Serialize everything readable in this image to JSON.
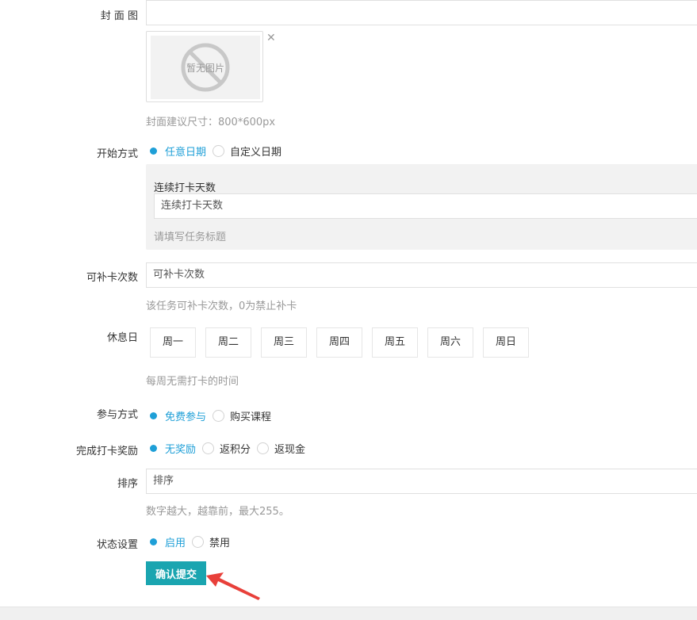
{
  "cover": {
    "label": "封 面 图",
    "placeholder_text": "暂无图片",
    "close_symbol": "✕",
    "hint": "封面建议尺寸：800*600px"
  },
  "start_mode": {
    "label": "开始方式",
    "options": [
      {
        "text": "任意日期",
        "selected": true
      },
      {
        "text": "自定义日期",
        "selected": false
      }
    ],
    "panel": {
      "field_label": "连续打卡天数",
      "input_placeholder": "连续打卡天数",
      "hint": "请填写任务标题"
    }
  },
  "makeup": {
    "label": "可补卡次数",
    "input_placeholder": "可补卡次数",
    "hint": "该任务可补卡次数，0为禁止补卡"
  },
  "rest_days": {
    "label": "休息日",
    "days": [
      "周一",
      "周二",
      "周三",
      "周四",
      "周五",
      "周六",
      "周日"
    ],
    "hint": "每周无需打卡的时间"
  },
  "join_mode": {
    "label": "参与方式",
    "options": [
      {
        "text": "免费参与",
        "selected": true
      },
      {
        "text": "购买课程",
        "selected": false
      }
    ]
  },
  "reward": {
    "label": "完成打卡奖励",
    "options": [
      {
        "text": "无奖励",
        "selected": true
      },
      {
        "text": "返积分",
        "selected": false
      },
      {
        "text": "返现金",
        "selected": false
      }
    ]
  },
  "sort": {
    "label": "排序",
    "input_placeholder": "排序",
    "hint": "数字越大，越靠前，最大255。"
  },
  "status": {
    "label": "状态设置",
    "options": [
      {
        "text": "启用",
        "selected": true
      },
      {
        "text": "禁用",
        "selected": false
      }
    ]
  },
  "submit_label": "确认提交",
  "colors": {
    "accent": "#1e9fd7",
    "submit": "#1aa5b0",
    "arrow": "#e8403a"
  }
}
